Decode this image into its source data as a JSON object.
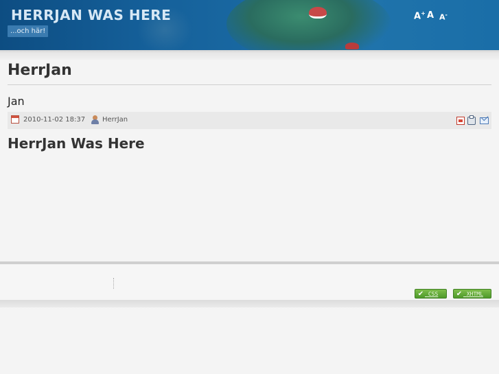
{
  "header": {
    "site_title": "HERRJAN WAS HERE",
    "tagline": "...och här!",
    "font_controls": {
      "increase": "A",
      "reset": "A",
      "decrease": "A"
    }
  },
  "article": {
    "page_title": "HerrJan",
    "author_heading": "Jan",
    "meta": {
      "date": "2010-11-02 18:37",
      "author": "HerrJan"
    },
    "heading": "HerrJan Was Here"
  },
  "footer": {
    "badges": {
      "css": "CSS",
      "xhtml": "XHTML"
    }
  }
}
